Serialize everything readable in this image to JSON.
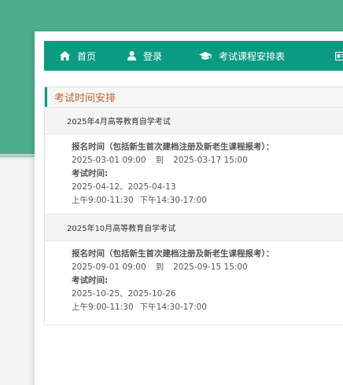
{
  "nav": {
    "items": [
      {
        "label": "首页",
        "icon": "home-icon"
      },
      {
        "label": "登录",
        "icon": "user-icon"
      },
      {
        "label": "考试课程安排表",
        "icon": "graduation-cap-icon"
      }
    ],
    "extra_icon": "id-card-icon"
  },
  "section": {
    "title": "考试时间安排"
  },
  "exams": [
    {
      "title": "2025年4月高等教育自学考试",
      "register_label": "报名时间（包括新生首次建档注册及新老生课程报考）：",
      "register_start": "2025-03-01 09:00",
      "to": "到",
      "register_end": "2025-03-17 15:00",
      "exam_label": "考试时间:",
      "exam_dates": "2025-04-12、2025-04-13",
      "exam_am": "上午9:00-11:30",
      "exam_pm": "下午14:30-17:00"
    },
    {
      "title": "2025年10月高等教育自学考试",
      "register_label": "报名时间（包括新生首次建档注册及新老生课程报考）：",
      "register_start": "2025-09-01 09:00",
      "to": "到",
      "register_end": "2025-09-15 15:00",
      "exam_label": "考试时间:",
      "exam_dates": "2025-10-25、2025-10-26",
      "exam_am": "上午9:00-11:30",
      "exam_pm": "下午14:30-17:00"
    }
  ],
  "colors": {
    "header_green": "#4caf8b",
    "nav_teal": "#0b9b82",
    "title_orange": "#c0622a"
  }
}
